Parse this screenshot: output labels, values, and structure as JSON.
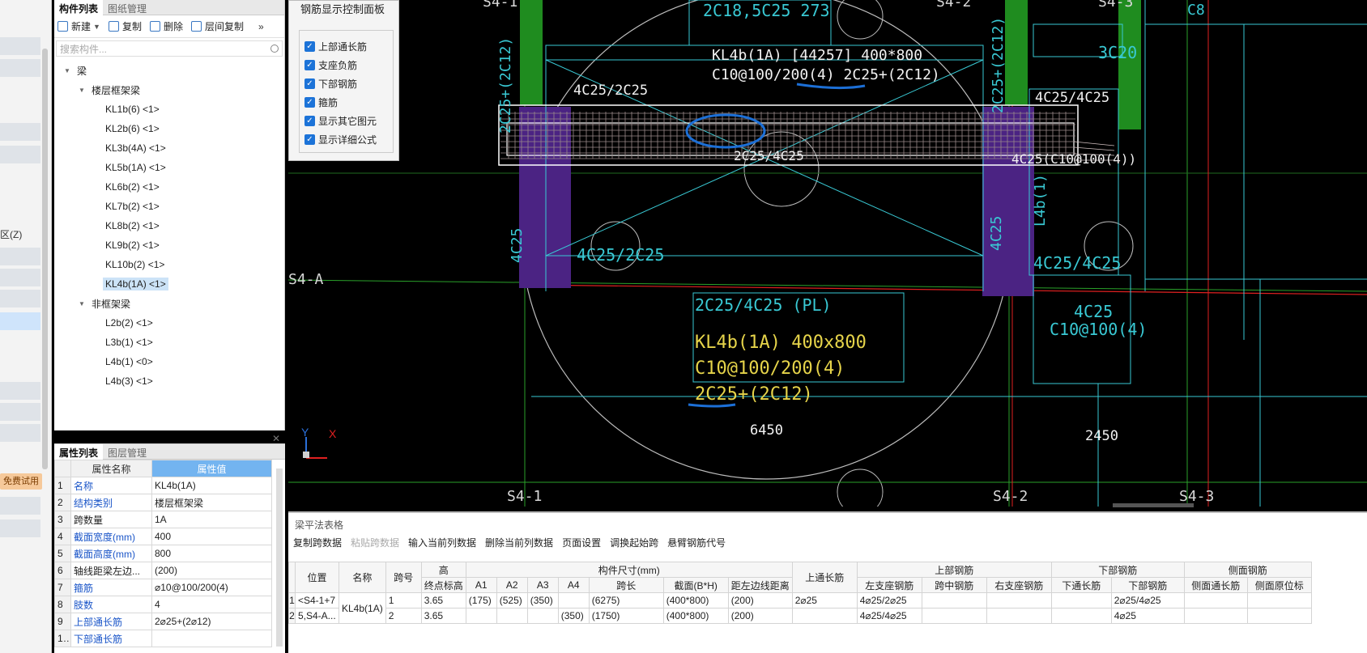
{
  "left_strip": {
    "label_z": "区(Z)",
    "trial_badge": "免费试用"
  },
  "component_panel": {
    "tabs": [
      "构件列表",
      "图纸管理"
    ],
    "toolbar": {
      "new": "新建",
      "copy": "复制",
      "delete": "删除",
      "floor_copy": "层间复制"
    },
    "search_placeholder": "搜索构件...",
    "tree": {
      "root": "梁",
      "group1": "楼层框架梁",
      "group1_items": [
        "KL1b(6) <1>",
        "KL2b(6) <1>",
        "KL3b(4A) <1>",
        "KL5b(1A) <1>",
        "KL6b(2) <1>",
        "KL7b(2) <1>",
        "KL8b(2) <1>",
        "KL9b(2) <1>",
        "KL10b(2) <1>",
        "KL4b(1A) <1>"
      ],
      "group2": "非框架梁",
      "group2_items": [
        "L2b(2) <1>",
        "L3b(1) <1>",
        "L4b(1) <0>",
        "L4b(3) <1>"
      ]
    }
  },
  "property_panel": {
    "tabs": [
      "属性列表",
      "图层管理"
    ],
    "headers": [
      "属性名称",
      "属性值"
    ],
    "rows": [
      {
        "no": "1",
        "name": "名称",
        "value": "KL4b(1A)"
      },
      {
        "no": "2",
        "name": "结构类别",
        "value": "楼层框架梁"
      },
      {
        "no": "3",
        "name": "跨数量",
        "value": "1A"
      },
      {
        "no": "4",
        "name": "截面宽度(mm)",
        "value": "400"
      },
      {
        "no": "5",
        "name": "截面高度(mm)",
        "value": "800"
      },
      {
        "no": "6",
        "name": "轴线距梁左边...",
        "value": "(200)"
      },
      {
        "no": "7",
        "name": "箍筋",
        "value": "⌀10@100/200(4)"
      },
      {
        "no": "8",
        "name": "肢数",
        "value": "4"
      },
      {
        "no": "9",
        "name": "上部通长筋",
        "value": "2⌀25+(2⌀12)"
      },
      {
        "no": "10",
        "name": "下部通长筋",
        "value": ""
      }
    ]
  },
  "control_panel": {
    "title": "钢筋显示控制面板",
    "options": [
      "上部通长筋",
      "支座负筋",
      "下部钢筋",
      "箍筋",
      "显示其它图元",
      "显示详细公式"
    ]
  },
  "cad": {
    "axis_top": [
      "S4-1",
      "S4-2",
      "S4-3"
    ],
    "axis_bottom": [
      "S4-1",
      "S4-2",
      "S4-3"
    ],
    "axis_left": "S4-A",
    "top_label": "2C18,5C25  273",
    "beam_label_line1": "KL4b(1A) [44257] 400*800",
    "beam_label_line2": "C10@100/200(4) 2C25+(2C12)",
    "left_support": "4C25/2C25",
    "right_support": "4C25/4C25",
    "right_stirrup": "4C25(C10@100(4))",
    "mid_label": "2C25/4C25",
    "bottom_left": "4C25/2C25",
    "bottom_right": "4C25/4C25",
    "pl_label": "2C25/4C25  (PL)",
    "yellow1": "KL4b(1A) 400x800",
    "yellow2": "C10@100/200(4)",
    "yellow3": "2C25+(2C12)",
    "dim1": "6450",
    "dim2": "2450",
    "c20": "3C20",
    "r_label1": "4C25",
    "r_label2": "C10@100(4)",
    "v_label1": "2C25+(2C12)",
    "v_label2": "4C25",
    "v_label3": "L4b(1)",
    "v_label4": "2C25+(2C12)",
    "v_label5": "4C25",
    "top_right_partial": "C8"
  },
  "beam_table": {
    "title": "梁平法表格",
    "toolbar": [
      "复制跨数据",
      "粘贴跨数据",
      "输入当前列数据",
      "删除当前列数据",
      "页面设置",
      "调换起始跨",
      "悬臂钢筋代号"
    ],
    "group_headers": {
      "elev": "高",
      "dims": "构件尺寸(mm)",
      "top": "上部钢筋",
      "bottom": "下部钢筋",
      "side": "侧面钢筋"
    },
    "headers": [
      "位置",
      "名称",
      "跨号",
      "终点标高",
      "A1",
      "A2",
      "A3",
      "A4",
      "跨长",
      "截面(B*H)",
      "距左边线距离",
      "上通长筋",
      "左支座钢筋",
      "跨中钢筋",
      "右支座钢筋",
      "下通长筋",
      "下部钢筋",
      "侧面通长筋",
      "侧面原位标"
    ],
    "position": [
      "<S4-1+7",
      "5,S4-A..."
    ],
    "name": "KL4b(1A)",
    "rows": [
      {
        "rn": "1",
        "span": "1",
        "elev": "3.65",
        "a1": "(175)",
        "a2": "(525)",
        "a3": "(350)",
        "a4": "",
        "len": "(6275)",
        "sec": "(400*800)",
        "dist": "(200)",
        "top_cont": "2⌀25",
        "left_sup": "4⌀25/2⌀25",
        "mid": "",
        "right_sup": "",
        "bot_cont": "",
        "bot": "2⌀25/4⌀25",
        "side": "",
        "side2": ""
      },
      {
        "rn": "2",
        "span": "2",
        "elev": "3.65",
        "a1": "",
        "a2": "",
        "a3": "",
        "a4": "(350)",
        "len": "(1750)",
        "sec": "(400*800)",
        "dist": "(200)",
        "top_cont": "",
        "left_sup": "4⌀25/4⌀25",
        "mid": "",
        "right_sup": "",
        "bot_cont": "",
        "bot": "4⌀25",
        "side": "",
        "side2": ""
      }
    ]
  },
  "colors": {
    "cad_bg": "#000000",
    "cyan": "#39c9d4",
    "green": "#1f8c1f",
    "purple": "#5a2b8f",
    "yellow": "#e6d44a",
    "blue_mark": "#1c6fd6",
    "accent": "#73b4f0"
  }
}
